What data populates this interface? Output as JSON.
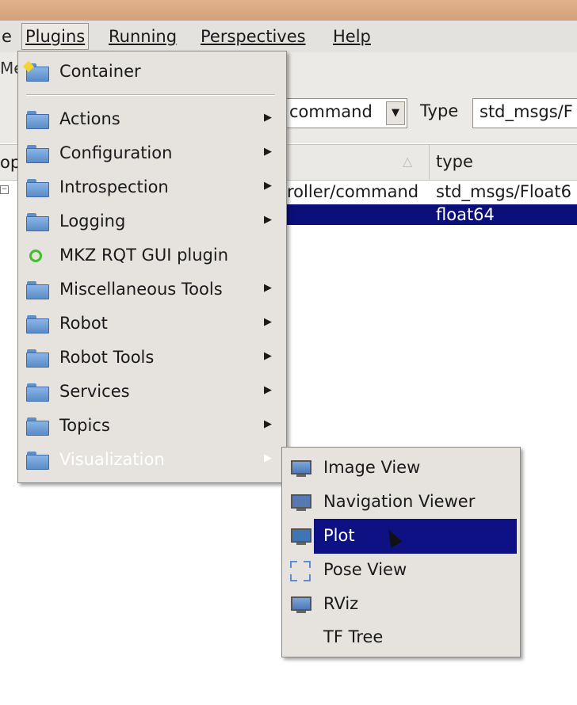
{
  "menubar": {
    "items": [
      {
        "label": "e"
      },
      {
        "label": "Plugins"
      },
      {
        "label": "Running"
      },
      {
        "label": "Perspectives"
      },
      {
        "label": "Help"
      }
    ]
  },
  "background": {
    "left_toolbar_text": "Me",
    "left_header_text": "op",
    "topic_combo_value": "command",
    "type_label": "Type",
    "type_value": "std_msgs/F",
    "table_header_type": "type",
    "row1_topic": "roller/command",
    "row1_type": "std_msgs/Float6",
    "row2_type": "float64"
  },
  "plugins_menu": {
    "container_label": "Container",
    "items": [
      {
        "label": "Actions",
        "icon": "folder-icon",
        "submenu": true
      },
      {
        "label": "Configuration",
        "icon": "folder-icon",
        "submenu": true
      },
      {
        "label": "Introspection",
        "icon": "folder-icon",
        "submenu": true
      },
      {
        "label": "Logging",
        "icon": "folder-icon",
        "submenu": true
      },
      {
        "label": "MKZ RQT GUI plugin",
        "icon": "plugin-ring-icon",
        "submenu": false
      },
      {
        "label": "Miscellaneous Tools",
        "icon": "folder-icon",
        "submenu": true
      },
      {
        "label": "Robot",
        "icon": "folder-icon",
        "submenu": true
      },
      {
        "label": "Robot Tools",
        "icon": "folder-icon",
        "submenu": true
      },
      {
        "label": "Services",
        "icon": "folder-icon",
        "submenu": true
      },
      {
        "label": "Topics",
        "icon": "folder-icon",
        "submenu": true
      },
      {
        "label": "Visualization",
        "icon": "folder-icon",
        "submenu": true,
        "highlighted": true
      }
    ]
  },
  "visualization_menu": {
    "items": [
      {
        "label": "Image View",
        "icon": "image-view-icon"
      },
      {
        "label": "Navigation Viewer",
        "icon": "monitor-icon"
      },
      {
        "label": "Plot",
        "icon": "plot-icon",
        "highlighted": true
      },
      {
        "label": "Pose View",
        "icon": "pose-view-icon"
      },
      {
        "label": "RViz",
        "icon": "rviz-icon"
      },
      {
        "label": "TF Tree",
        "icon": ""
      }
    ]
  },
  "colors": {
    "highlight": "#0d1183",
    "menu_bg": "#e6e3df",
    "titlebar": "#d8a880"
  }
}
